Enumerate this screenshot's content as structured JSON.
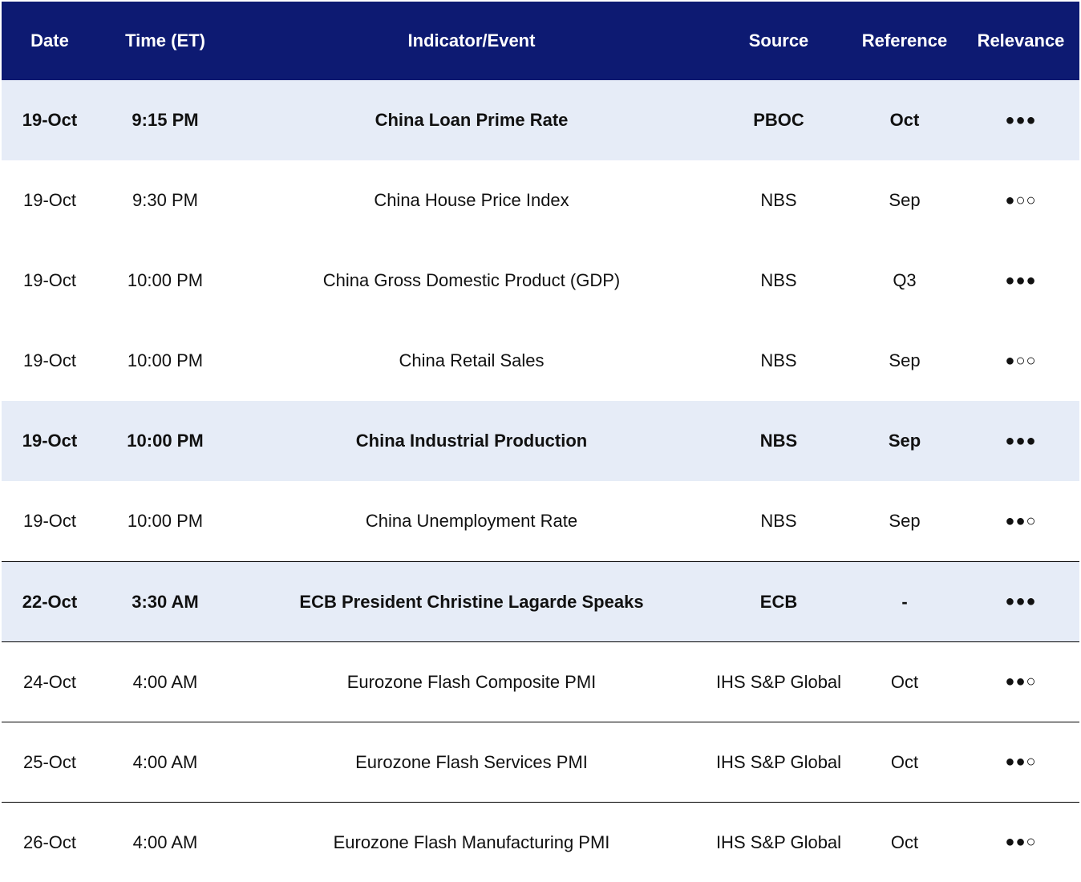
{
  "headers": {
    "date": "Date",
    "time": "Time (ET)",
    "indicator": "Indicator/Event",
    "source": "Source",
    "reference": "Reference",
    "relevance": "Relevance"
  },
  "rows": [
    {
      "date": "19-Oct",
      "time": "9:15 PM",
      "indicator": "China Loan Prime Rate",
      "source": "PBOC",
      "reference": "Oct",
      "relevance": "●●●"
    },
    {
      "date": "19-Oct",
      "time": "9:30 PM",
      "indicator": "China House Price Index",
      "source": "NBS",
      "reference": "Sep",
      "relevance": "●○○"
    },
    {
      "date": "19-Oct",
      "time": "10:00 PM",
      "indicator": "China Gross Domestic Product (GDP)",
      "source": "NBS",
      "reference": "Q3",
      "relevance": "●●●"
    },
    {
      "date": "19-Oct",
      "time": "10:00 PM",
      "indicator": "China Retail Sales",
      "source": "NBS",
      "reference": "Sep",
      "relevance": "●○○"
    },
    {
      "date": "19-Oct",
      "time": "10:00 PM",
      "indicator": "China Industrial Production",
      "source": "NBS",
      "reference": "Sep",
      "relevance": "●●●"
    },
    {
      "date": "19-Oct",
      "time": "10:00 PM",
      "indicator": "China Unemployment Rate",
      "source": "NBS",
      "reference": "Sep",
      "relevance": "●●○"
    },
    {
      "date": "22-Oct",
      "time": "3:30 AM",
      "indicator": "ECB President Christine Lagarde Speaks",
      "source": "ECB",
      "reference": "-",
      "relevance": "●●●"
    },
    {
      "date": "24-Oct",
      "time": "4:00 AM",
      "indicator": "Eurozone Flash Composite PMI",
      "source": "IHS S&P Global",
      "reference": "Oct",
      "relevance": "●●○"
    },
    {
      "date": "25-Oct",
      "time": "4:00 AM",
      "indicator": "Eurozone Flash Services PMI",
      "source": "IHS S&P Global",
      "reference": "Oct",
      "relevance": "●●○"
    },
    {
      "date": "26-Oct",
      "time": "4:00 AM",
      "indicator": "Eurozone Flash Manufacturing PMI",
      "source": "IHS S&P Global",
      "reference": "Oct",
      "relevance": "●●○"
    }
  ],
  "colors": {
    "header_bg": "#0d1a72",
    "highlight_bg": "#e6ecf7"
  }
}
